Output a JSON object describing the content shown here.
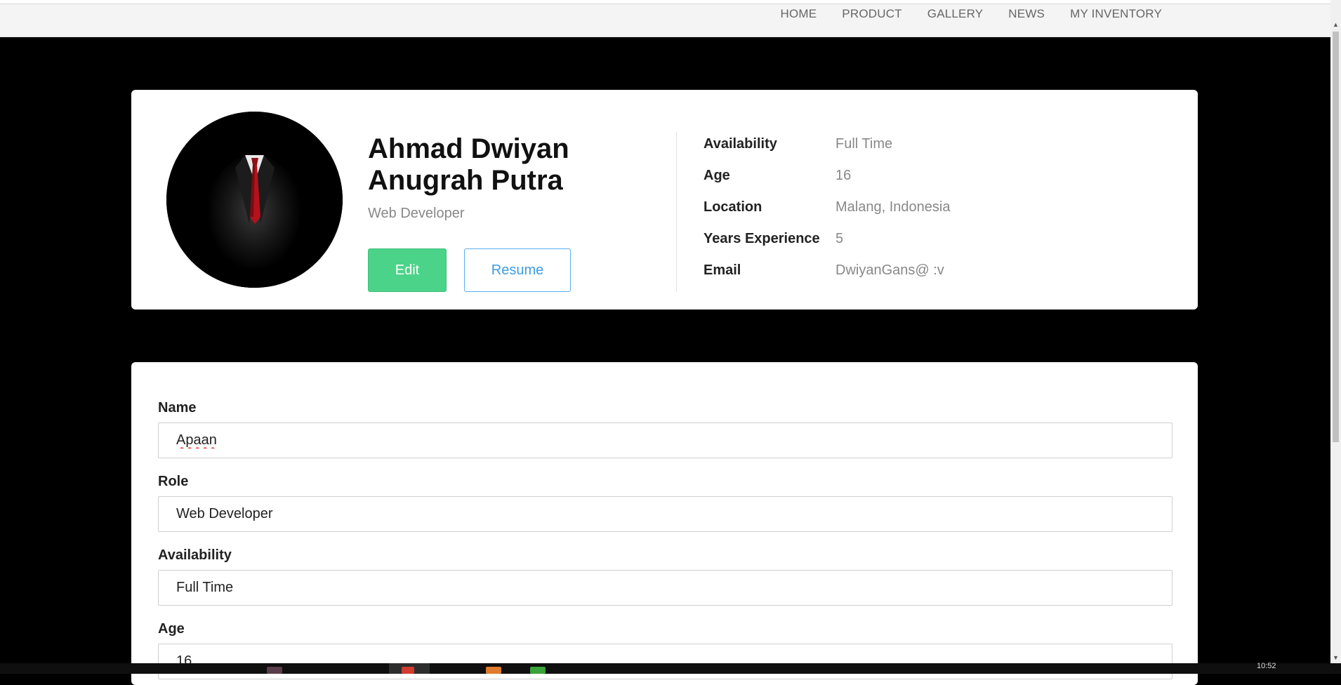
{
  "nav": {
    "items": [
      "HOME",
      "PRODUCT",
      "GALLERY",
      "NEWS",
      "MY INVENTORY"
    ]
  },
  "profile": {
    "name": "Ahmad Dwiyan Anugrah Putra",
    "role": "Web Developer",
    "edit_label": "Edit",
    "resume_label": "Resume",
    "details": [
      {
        "label": "Availability",
        "value": "Full Time"
      },
      {
        "label": "Age",
        "value": "16"
      },
      {
        "label": "Location",
        "value": "Malang, Indonesia"
      },
      {
        "label": "Years Experience",
        "value": "5"
      },
      {
        "label": "Email",
        "value": "DwiyanGans@ :v"
      }
    ]
  },
  "form": {
    "fields": [
      {
        "label": "Name",
        "value": "Apaan"
      },
      {
        "label": "Role",
        "value": "Web Developer"
      },
      {
        "label": "Availability",
        "value": "Full Time"
      },
      {
        "label": "Age",
        "value": "16"
      }
    ]
  },
  "taskbar": {
    "clock": "10:52"
  },
  "colors": {
    "edit_button": "#4cd38a",
    "resume_button_border": "#58aef0",
    "page_background": "#000000"
  }
}
